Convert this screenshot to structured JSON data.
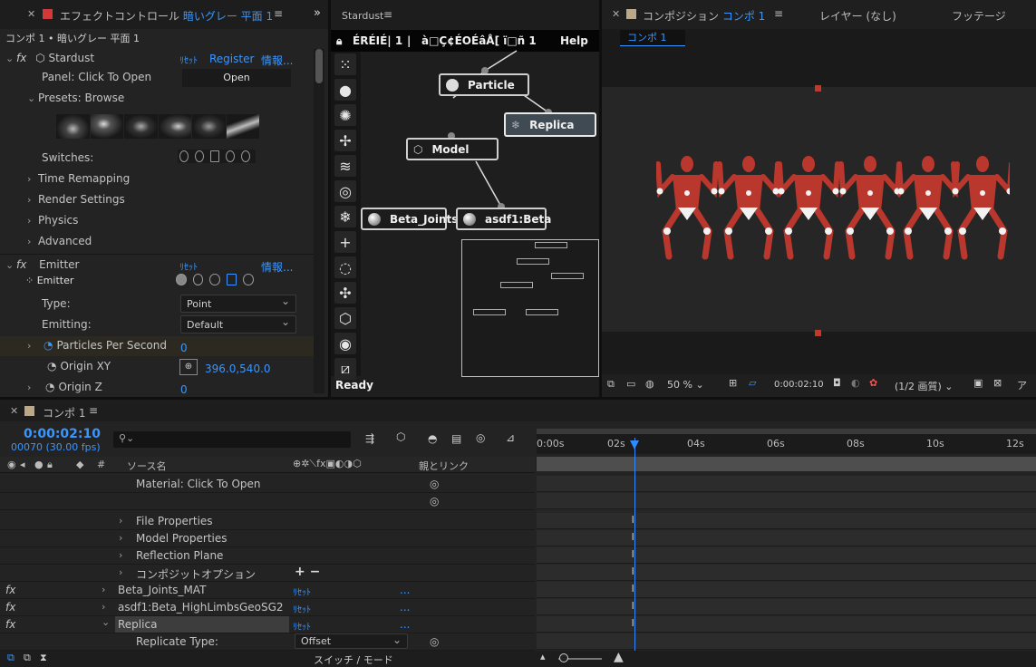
{
  "effect_panel": {
    "tab_title": "エフェクトコントロール",
    "tab_layer": "暗いグレー 平面 1",
    "breadcrumb": "コンポ 1 • 暗いグレー 平面 1",
    "effect_name": "Stardust",
    "reset": "ﾘｾｯﾄ",
    "register": "Register",
    "info": "情報...",
    "panel_label": "Panel: Click To Open",
    "open_button": "Open",
    "presets_label": "Presets: Browse",
    "switches_label": "Switches:",
    "groups": [
      "Time Remapping",
      "Render Settings",
      "Physics",
      "Advanced"
    ],
    "emitter_group": "Emitter",
    "emitter_sub": "Emitter",
    "type_label": "Type:",
    "type_value": "Point",
    "emitting_label": "Emitting:",
    "emitting_value": "Default",
    "pps_label": "Particles Per Second",
    "pps_value": "0",
    "origin_xy_label": "Origin XY",
    "origin_xy_value": "396.0,540.0",
    "origin_z_label": "Origin Z",
    "origin_z_value": "0"
  },
  "stardust_panel": {
    "tab_title": "Stardust",
    "title_text": "ÉRÉIÉ| 1",
    "sep": "|",
    "title_text2": "à□Ç¢ÉOÉâÅ[ ï□ñ  1",
    "help": "Help",
    "status": "Ready",
    "nodes": {
      "particle": "Particle",
      "replica": "Replica",
      "model": "Model",
      "beta_joints": "Beta_Joints",
      "asdf1": "asdf1:Beta"
    },
    "tools": [
      "emitter-icon",
      "sphere-icon",
      "burst-icon",
      "fan-icon",
      "wave-icon",
      "target-icon",
      "snowflake-icon",
      "plus-icon",
      "ring-icon",
      "cluster-icon",
      "cube-icon",
      "ball-icon",
      "slash-icon"
    ]
  },
  "comp_panel": {
    "tab_title": "コンポジション",
    "tab_comp": "コンポ 1",
    "tab_layer": "レイヤー (なし)",
    "tab_footage": "フッテージ",
    "comp_chip": "コンポ 1",
    "zoom": "50 %",
    "timecode": "0:00:02:10",
    "resolution": "(1/2 画質)",
    "more": "ア",
    "figure_color": "#b9372c"
  },
  "timeline": {
    "tab_title": "コンポ 1",
    "timecode": "0:00:02:10",
    "frames": "00070 (30.00 fps)",
    "search_placeholder": "",
    "col_source": "ソース名",
    "col_parent": "親とリンク",
    "col_hash": "#",
    "ruler": [
      "0:00s",
      "02s",
      "04s",
      "06s",
      "08s",
      "10s",
      "12s"
    ],
    "rows": [
      {
        "name": "Material: Click To Open",
        "expandable": false
      },
      {
        "name": "",
        "expandable": false
      },
      {
        "name": "File Properties",
        "expandable": true
      },
      {
        "name": "Model Properties",
        "expandable": true
      },
      {
        "name": "Reflection Plane",
        "expandable": true
      },
      {
        "name": "コンポジットオプション",
        "expandable": true
      }
    ],
    "fx_rows": [
      {
        "name": "Beta_Joints_MAT",
        "reset": "ﾘｾｯﾄ",
        "dots": "..."
      },
      {
        "name": "asdf1:Beta_HighLimbsGeoSG2",
        "reset": "ﾘｾｯﾄ",
        "dots": "..."
      },
      {
        "name": "Replica",
        "reset": "ﾘｾｯﾄ",
        "dots": "..."
      }
    ],
    "replicate_type_label": "Replicate Type:",
    "replicate_type_value": "Offset",
    "add_remove": "+ −",
    "switch_mode": "スイッチ / モード",
    "playhead_seconds": 2.333,
    "accent": "#2f8bff"
  }
}
